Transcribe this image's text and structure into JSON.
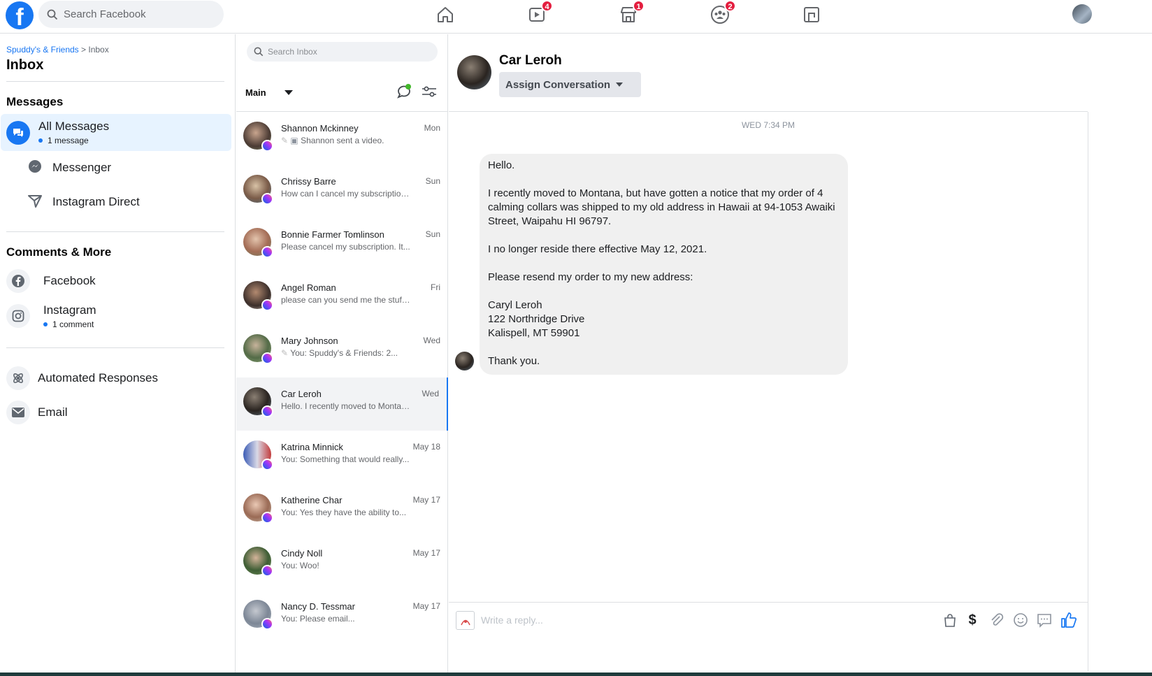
{
  "topbar": {
    "search_placeholder": "Search Facebook",
    "nav": [
      {
        "name": "home",
        "badge": ""
      },
      {
        "name": "watch",
        "badge": "4"
      },
      {
        "name": "marketplace",
        "badge": "1"
      },
      {
        "name": "groups",
        "badge": "2"
      },
      {
        "name": "gaming",
        "badge": ""
      }
    ]
  },
  "sidebar": {
    "breadcrumb_page": "Spuddy's & Friends",
    "breadcrumb_sep": " > ",
    "breadcrumb_current": "Inbox",
    "title": "Inbox",
    "messages_heading": "Messages",
    "all_messages": "All Messages",
    "all_messages_count": "1 message",
    "messenger": "Messenger",
    "instagram_direct": "Instagram Direct",
    "comments_heading": "Comments & More",
    "facebook": "Facebook",
    "instagram": "Instagram",
    "instagram_count": "1 comment",
    "automated": "Automated Responses",
    "email": "Email"
  },
  "list": {
    "search_placeholder": "Search Inbox",
    "filter": "Main",
    "conversations": [
      {
        "name": "Shannon Mckinney",
        "snippet": "Shannon sent a video.",
        "time": "Mon"
      },
      {
        "name": "Chrissy Barre",
        "snippet": "How can I cancel my subscription...",
        "time": "Sun"
      },
      {
        "name": "Bonnie Farmer Tomlinson",
        "snippet": "Please cancel my subscription. It...",
        "time": "Sun"
      },
      {
        "name": "Angel Roman",
        "snippet": "please can you send me the stuff f...",
        "time": "Fri"
      },
      {
        "name": "Mary Johnson",
        "snippet": "You: Spuddy's & Friends: 2...",
        "time": "Wed"
      },
      {
        "name": "Car Leroh",
        "snippet": "Hello. I recently moved to Montan...",
        "time": "Wed"
      },
      {
        "name": "Katrina Minnick",
        "snippet": "You: Something that would really...",
        "time": "May 18"
      },
      {
        "name": "Katherine Char",
        "snippet": "You: Yes they have the ability to...",
        "time": "May 17"
      },
      {
        "name": "Cindy Noll",
        "snippet": "You: Woo!",
        "time": "May 17"
      },
      {
        "name": "Nancy D. Tessmar",
        "snippet": "You: Please email...",
        "time": "May 17"
      }
    ]
  },
  "chat": {
    "name": "Car Leroh",
    "assign_label": "Assign Conversation",
    "timestamp": "WED 7:34 PM",
    "message_lines": [
      "Hello.",
      "",
      "I recently moved to Montana, but have gotten a notice that my order of 4 calming collars was shipped to my old address in Hawaii at 94-1053 Awaiki Street, Waipahu HI 96797.",
      "",
      "I no longer reside there effective May 12, 2021.",
      "",
      "Please resend my order to my new address:",
      "",
      "Caryl Leroh",
      "122 Northridge Drive",
      "Kalispell, MT 59901",
      "",
      "Thank you."
    ],
    "reply_placeholder": "Write a reply..."
  },
  "colors": {
    "accent": "#1877f2",
    "badge": "#e41e3f",
    "active_bg": "#e7f3ff"
  }
}
